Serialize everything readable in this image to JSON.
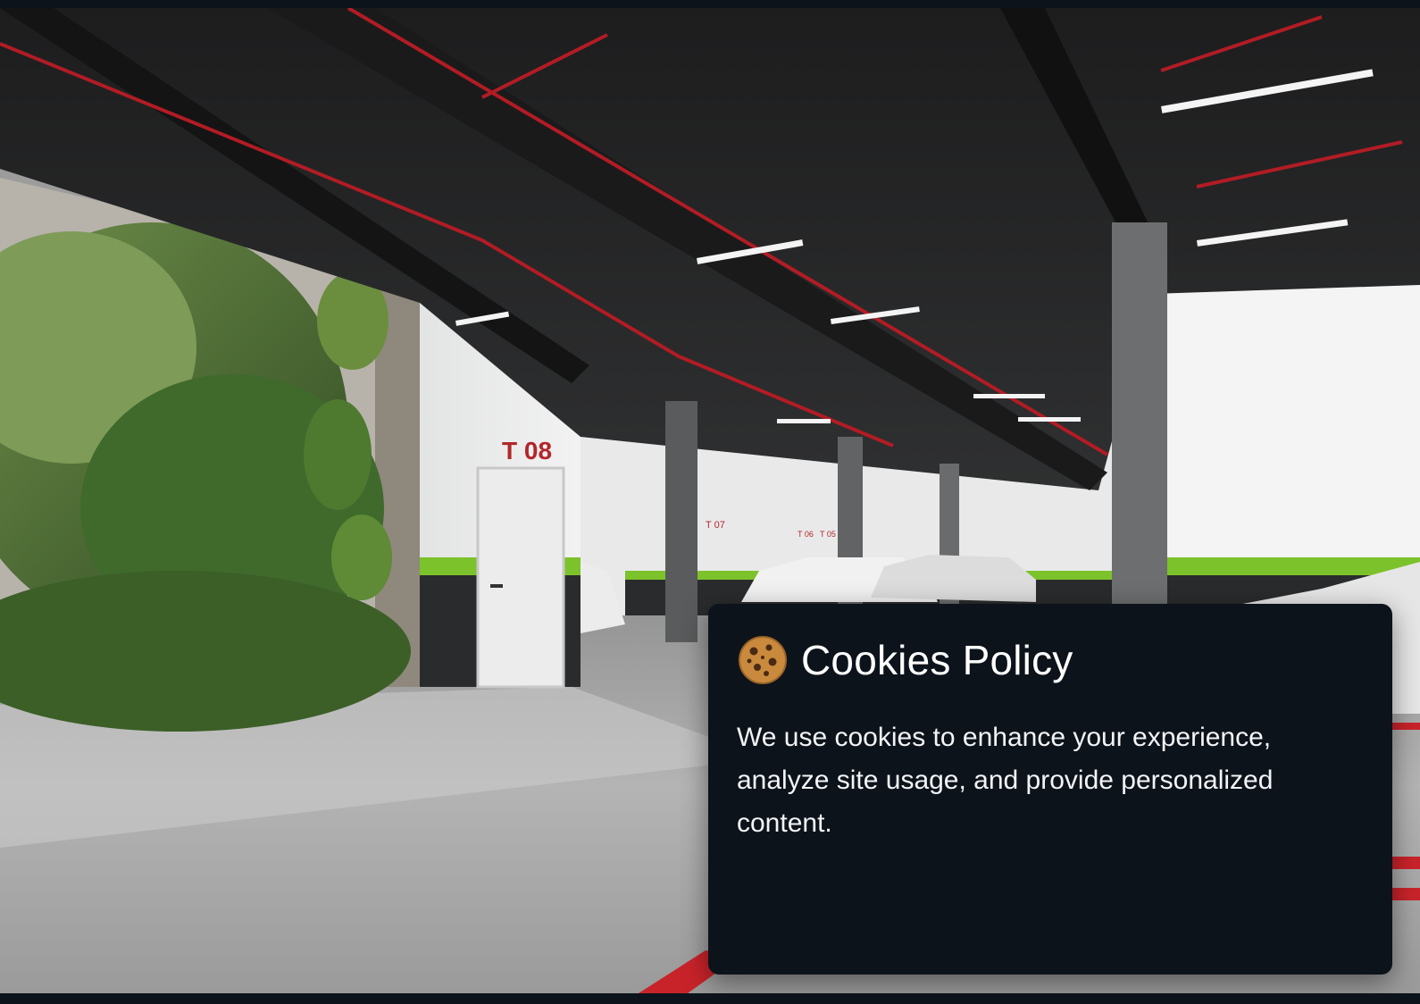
{
  "photo": {
    "door_sign": "T 08",
    "sign_small_1": "T 07",
    "sign_small_2": "T 06",
    "sign_small_3": "T 05"
  },
  "cookie_banner": {
    "icon": "cookie-icon",
    "title": "Cookies Policy",
    "description": "We use cookies to enhance your experience, analyze site usage, and provide personalized content."
  },
  "colors": {
    "banner_bg": "#0d131b",
    "text": "#ffffff",
    "accent_green": "#7cc22a",
    "pipe_red": "#b21c24"
  }
}
